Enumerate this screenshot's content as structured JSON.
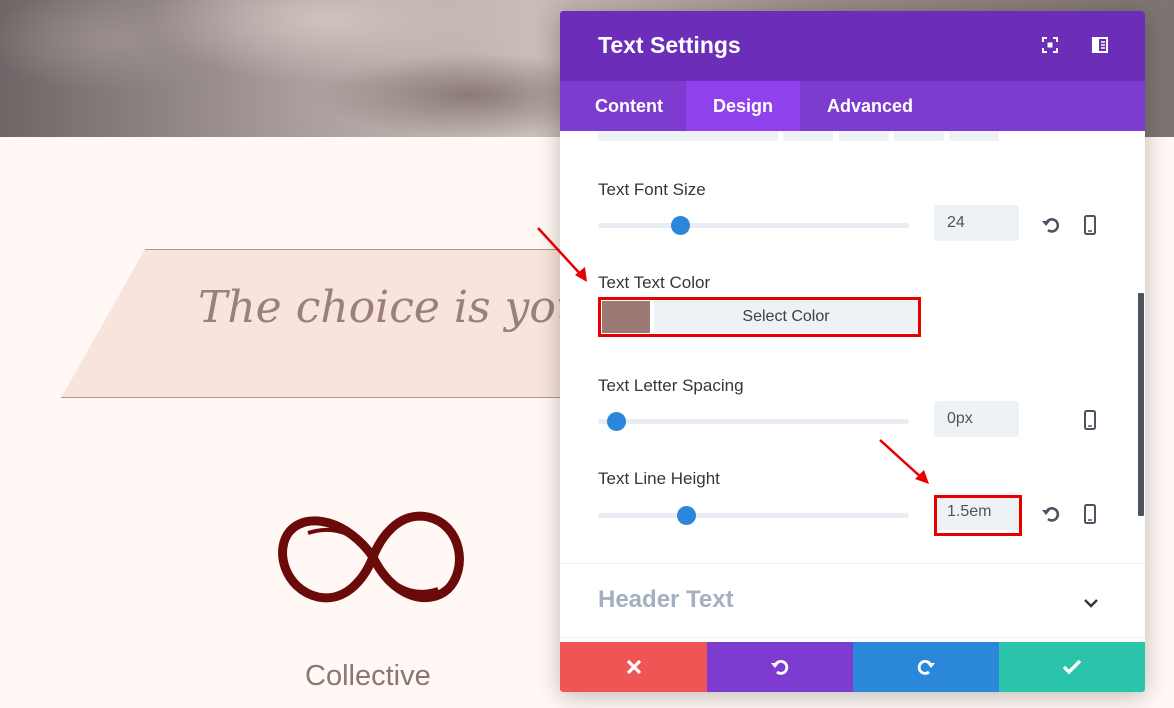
{
  "background": {
    "banner_text": "The choice is yours",
    "brand_text": "Collective"
  },
  "modal": {
    "title": "Text Settings",
    "tabs": [
      {
        "label": "Content",
        "active": false
      },
      {
        "label": "Design",
        "active": true
      },
      {
        "label": "Advanced",
        "active": false
      }
    ],
    "fields": {
      "font_size": {
        "label": "Text Font Size",
        "value": "24",
        "slider_fraction": 0.25
      },
      "text_color": {
        "label": "Text Text Color",
        "button_label": "Select Color",
        "swatch": "#9b7a73"
      },
      "letter_spacing": {
        "label": "Text Letter Spacing",
        "value": "0px",
        "slider_fraction": 0.03
      },
      "line_height": {
        "label": "Text Line Height",
        "value": "1.5em",
        "slider_fraction": 0.27
      }
    },
    "sections": [
      {
        "title": "Header Text",
        "expanded": false
      }
    ]
  },
  "colors": {
    "header_purple": "#6c2eb9",
    "tab_purple": "#7e3bd0",
    "active_tab": "#8f42ec",
    "cancel_red": "#ef5555",
    "redo_blue": "#2b87da",
    "save_green": "#29c4a9",
    "highlight_red": "#e60000",
    "logo_maroon": "#6b0a0a"
  },
  "icons": {
    "header": [
      "expand-icon",
      "split-view-icon"
    ],
    "footer": [
      "close-icon",
      "undo-icon",
      "redo-icon",
      "check-icon"
    ]
  }
}
